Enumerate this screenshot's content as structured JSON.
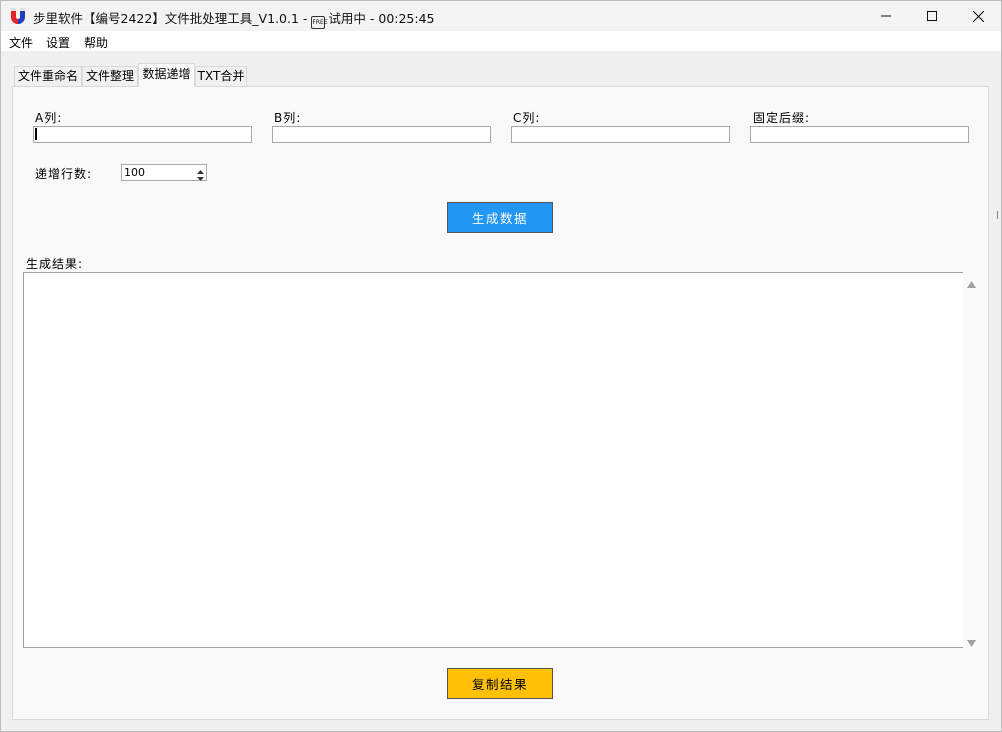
{
  "window": {
    "title_prefix": "步里软件【编号2422】文件批处理工具_V1.0.1 -",
    "free_badge": "FREE",
    "title_suffix": "试用中 - 00:25:45",
    "logo_icon": "magnet-u-icon",
    "minimize_icon": "minimize-icon",
    "maximize_icon": "maximize-icon",
    "close_icon": "close-icon"
  },
  "menu": {
    "items": [
      {
        "label": "文件"
      },
      {
        "label": "设置"
      },
      {
        "label": "帮助"
      }
    ]
  },
  "tabs": [
    {
      "label": "文件重命名",
      "active": false
    },
    {
      "label": "文件整理",
      "active": false
    },
    {
      "label": "数据递增",
      "active": true
    },
    {
      "label": "TXT合并",
      "active": false
    }
  ],
  "form": {
    "col_a_label": "A列:",
    "col_a_value": "",
    "col_b_label": "B列:",
    "col_b_value": "",
    "col_c_label": "C列:",
    "col_c_value": "",
    "suffix_label": "固定后缀:",
    "suffix_value": "",
    "rows_label": "递增行数:",
    "rows_value": "100",
    "generate_button": "生成数据",
    "result_label": "生成结果:",
    "result_value": "",
    "copy_button": "复制结果"
  },
  "colors": {
    "generate_button_bg": "#2196f3",
    "copy_button_bg": "#ffc107",
    "logo_red": "#e4262b",
    "logo_blue": "#1f3fbf"
  }
}
